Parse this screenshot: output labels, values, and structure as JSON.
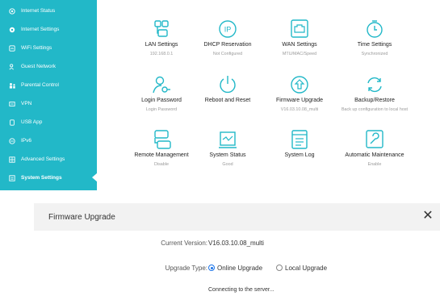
{
  "accent_color": "#22b8c8",
  "sidebar": {
    "items": [
      {
        "label": "Internet Status",
        "icon": "globe-icon"
      },
      {
        "label": "Internet Settings",
        "icon": "settings-globe-icon"
      },
      {
        "label": "WiFi Settings",
        "icon": "wifi-icon"
      },
      {
        "label": "Guest Network",
        "icon": "guest-icon"
      },
      {
        "label": "Parental Control",
        "icon": "parental-control-icon"
      },
      {
        "label": "VPN",
        "icon": "vpn-icon"
      },
      {
        "label": "USB App",
        "icon": "usb-icon"
      },
      {
        "label": "IPv6",
        "icon": "ipv6-icon"
      },
      {
        "label": "Advanced Settings",
        "icon": "advanced-icon"
      },
      {
        "label": "System Settings",
        "icon": "system-settings-icon",
        "active": true
      }
    ]
  },
  "tiles": [
    {
      "title": "LAN Settings",
      "subtitle": "192.168.0.1",
      "icon": "lan-icon"
    },
    {
      "title": "DHCP Reservation",
      "subtitle": "Not Configured",
      "icon": "ip-icon"
    },
    {
      "title": "WAN Settings",
      "subtitle": "MTU/MAC/Speed",
      "icon": "wan-port-icon"
    },
    {
      "title": "Time Settings",
      "subtitle": "Synchronized",
      "icon": "timer-icon"
    },
    {
      "title": "Login Password",
      "subtitle": "Login Password",
      "icon": "user-key-icon"
    },
    {
      "title": "Reboot and Reset",
      "subtitle": "",
      "icon": "power-icon"
    },
    {
      "title": "Firmware Upgrade",
      "subtitle": "V16.03.10.08_multi",
      "icon": "upgrade-icon"
    },
    {
      "title": "Backup/Restore",
      "subtitle": "Back up configuration to local host",
      "icon": "sync-icon"
    },
    {
      "title": "Remote Management",
      "subtitle": "Disable",
      "icon": "remote-management-icon"
    },
    {
      "title": "System Status",
      "subtitle": "Good",
      "icon": "status-monitor-icon"
    },
    {
      "title": "System Log",
      "subtitle": "",
      "icon": "log-icon"
    },
    {
      "title": "Automatic Maintenance",
      "subtitle": "Enable",
      "icon": "wrench-icon"
    }
  ],
  "dialog": {
    "title": "Firmware Upgrade",
    "close_label": "✕",
    "current_version_label": "Current Version:",
    "current_version_value": "V16.03.10.08_multi",
    "upgrade_type_label": "Upgrade Type:",
    "online_label": "Online Upgrade",
    "local_label": "Local Upgrade",
    "selected": "online",
    "status_text": "Connecting to the server..."
  }
}
